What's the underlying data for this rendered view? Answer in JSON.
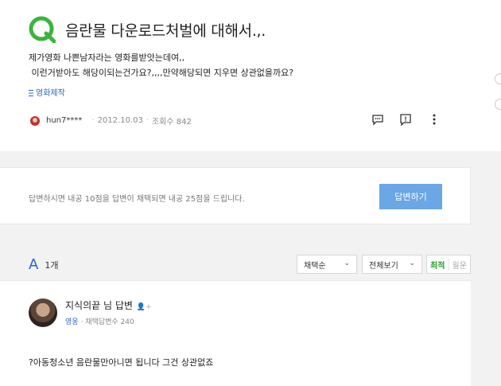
{
  "question": {
    "title": "음란물 다운로드처벌에 대해서.,.",
    "body_line1": "제가영화 나쁜남자라는 영화를받앗는데여,,",
    "body_line2": " 이런거받아도 해당이되는건가요?,,,,만약해당되면 지우면 상관없을까요?",
    "category": "영화제작",
    "user": "hun7****",
    "date": "2012.10.03",
    "views": "조회수 842",
    "colors": {
      "logo": "#3cb43c",
      "link": "#2a64c8"
    }
  },
  "answer_prompt": {
    "notice": "답변하시면 내공 10점을 답변이 채택되면 내공 25점을 드립니다.",
    "button_label": "답변하기"
  },
  "answers_header": {
    "letter": "A",
    "count": "1개",
    "sort_select": "채택순",
    "filter_select": "전체보기",
    "seg_latest": "최적",
    "seg_old": "월운"
  },
  "answer": {
    "author": "지식의끝 님 답변",
    "grade": "영웅",
    "stats": "· 채택답변수 240",
    "text": "?아동청소년 음란물만아니면 됩니다 그건 상관없죠"
  }
}
